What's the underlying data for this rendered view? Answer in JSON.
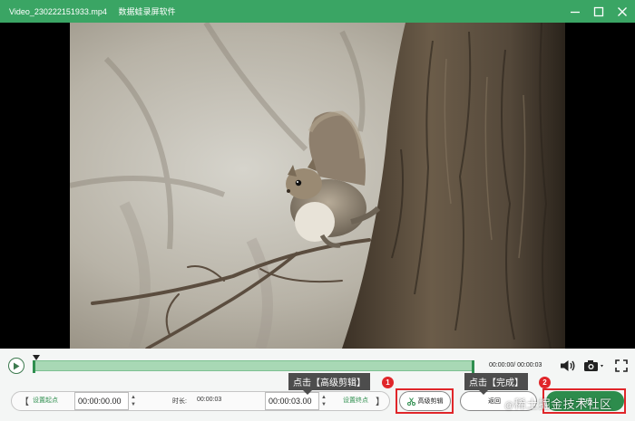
{
  "window": {
    "filename": "Video_230222151933.mp4",
    "app_name": "数据蛙录屏软件"
  },
  "player": {
    "progress": 0.0,
    "time_display": "00:00:00/ 00:00:03"
  },
  "segment": {
    "left_bracket": "【",
    "set_start_label": "设置起点",
    "start_time": "00:00:00.00",
    "duration_label": "时长:",
    "duration_value": "00:00:03",
    "end_time": "00:00:03.00",
    "set_end_label": "设置终点",
    "right_bracket": "】"
  },
  "buttons": {
    "advanced_edit": "高级剪辑",
    "back": "返回",
    "done": "完成"
  },
  "annotations": {
    "tip1": "点击【高级剪辑】",
    "badge1": "1",
    "tip2": "点击【完成】",
    "badge2": "2",
    "highlight_color": "#e0262a"
  },
  "watermark": {
    "at": "@",
    "text": "稀土掘金技术社区"
  },
  "colors": {
    "titlebar": "#3aa564",
    "accent": "#2d8c4c"
  }
}
